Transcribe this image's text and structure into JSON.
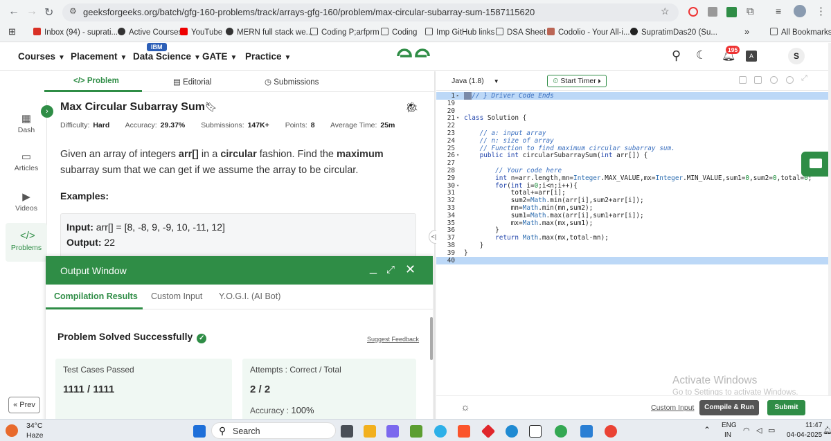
{
  "browser": {
    "url": "geeksforgeeks.org/batch/gfg-160-problems/track/arrays-gfg-160/problem/max-circular-subarray-sum-1587115620"
  },
  "bookmarks": [
    "Inbox (94) - suprati...",
    "Active Courses",
    "YouTube",
    "MERN full stack we...",
    "Coding P;arfprm",
    "Coding",
    "Imp GitHub links",
    "DSA Sheet",
    "Codolio - Your All-i...",
    "SupratimDas20 (Su...",
    "All Bookmarks"
  ],
  "header": {
    "menus": [
      "Courses",
      "Placement",
      "Data Science",
      "GATE",
      "Practice"
    ],
    "ibm_badge": "IBM",
    "notif_count": "195",
    "avatar_letter": "S"
  },
  "sidebar": {
    "items": [
      "Dash",
      "Articles",
      "Videos",
      "Problems"
    ],
    "prev": "« Prev"
  },
  "problem_tabs": [
    "Problem",
    "Editorial",
    "Submissions"
  ],
  "problem": {
    "title": "Max Circular Subarray Sum",
    "difficulty_label": "Difficulty:",
    "difficulty": "Hard",
    "accuracy_label": "Accuracy:",
    "accuracy": "29.37%",
    "submissions_label": "Submissions:",
    "submissions": "147K+",
    "points_label": "Points:",
    "points": "8",
    "avg_time_label": "Average Time:",
    "avg_time": "25m",
    "statement_a": "Given an array of integers ",
    "statement_b": "arr[]",
    "statement_c": " in a ",
    "statement_d": "circular",
    "statement_e": " fashion. Find the ",
    "statement_f": "maximum",
    "statement_g": " subarray sum that we can get if we assume the array to be circular.",
    "examples_heading": "Examples:",
    "input_label": "Input:",
    "input_value": " arr[] = [8, -8, 9, -9, 10, -11, 12]",
    "output_label": "Output:",
    "output_value": " 22"
  },
  "output_window": {
    "title": "Output Window",
    "tabs": [
      "Compilation Results",
      "Custom Input",
      "Y.O.G.I. (AI Bot)"
    ],
    "status": "Problem Solved Successfully",
    "suggest_feedback": "Suggest Feedback",
    "tests_label": "Test Cases Passed",
    "tests_value": "1111 / 1111",
    "attempts_label": "Attempts : Correct / Total",
    "attempts_value": "2 / 2",
    "accuracy_label": "Accuracy : ",
    "accuracy_value": "100%"
  },
  "editor": {
    "language": "Java (1.8)",
    "start_timer": "Start Timer",
    "custom_input": "Custom Input",
    "compile_run": "Compile & Run",
    "submit": "Submit"
  },
  "code_lines": [
    {
      "n": "1",
      "fold": "▸",
      "hl": true,
      "html": "<span style=\"background:#7a8aa8;color:#7a8aa8\">▭▭</span><span class=\"cm\">// } Driver Code Ends</span>"
    },
    {
      "n": "19",
      "html": ""
    },
    {
      "n": "20",
      "html": ""
    },
    {
      "n": "21",
      "fold": "▾",
      "html": "<span class=\"kw\">class</span> Solution {"
    },
    {
      "n": "22",
      "html": ""
    },
    {
      "n": "23",
      "html": "    <span class=\"cm\">// a: input array</span>"
    },
    {
      "n": "24",
      "html": "    <span class=\"cm\">// n: size of array</span>"
    },
    {
      "n": "25",
      "html": "    <span class=\"cm\">// Function to find maximum circular subarray sum.</span>"
    },
    {
      "n": "26",
      "fold": "▾",
      "html": "    <span class=\"kw\">public int</span> circularSubarraySum(<span class=\"kw\">int</span> arr[]) {"
    },
    {
      "n": "27",
      "html": ""
    },
    {
      "n": "28",
      "html": "        <span class=\"cm\">// Your code here</span>"
    },
    {
      "n": "29",
      "html": "        <span class=\"kw\">int</span> n=arr.length,mn=<span class=\"fn\">Integer</span>.MAX_VALUE,mx=<span class=\"fn\">Integer</span>.MIN_VALUE,sum1=<span class=\"num\">0</span>,sum2=<span class=\"num\">0</span>,total=<span class=\"num\">0</span>;"
    },
    {
      "n": "30",
      "fold": "▾",
      "html": "        <span class=\"kw\">for</span>(<span class=\"kw\">int</span> i=<span class=\"num\">0</span>;i&lt;n;i++){"
    },
    {
      "n": "31",
      "html": "            total+=arr[i];"
    },
    {
      "n": "32",
      "html": "            sum2=<span class=\"fn\">Math</span>.min(arr[i],sum2+arr[i]);"
    },
    {
      "n": "33",
      "html": "            mn=<span class=\"fn\">Math</span>.min(mn,sum2);"
    },
    {
      "n": "34",
      "html": "            sum1=<span class=\"fn\">Math</span>.max(arr[i],sum1+arr[i]);"
    },
    {
      "n": "35",
      "html": "            mx=<span class=\"fn\">Math</span>.max(mx,sum1);"
    },
    {
      "n": "36",
      "html": "        }"
    },
    {
      "n": "37",
      "html": "        <span class=\"kw\">return</span> <span class=\"fn\">Math</span>.max(mx,total-mn);"
    },
    {
      "n": "38",
      "html": "    }"
    },
    {
      "n": "39",
      "html": "}"
    },
    {
      "n": "40",
      "hl": true,
      "html": ""
    }
  ],
  "watermark": {
    "title": "Activate Windows",
    "sub": "Go to Settings to activate Windows."
  },
  "taskbar": {
    "weather_temp": "34°C",
    "weather_desc": "Haze",
    "search": "Search",
    "lang1": "ENG",
    "lang2": "IN",
    "time": "11:47",
    "date": "04-04-2025"
  },
  "colors": {
    "brand": "#2f8d46",
    "ibm": "#2d5fb7"
  }
}
